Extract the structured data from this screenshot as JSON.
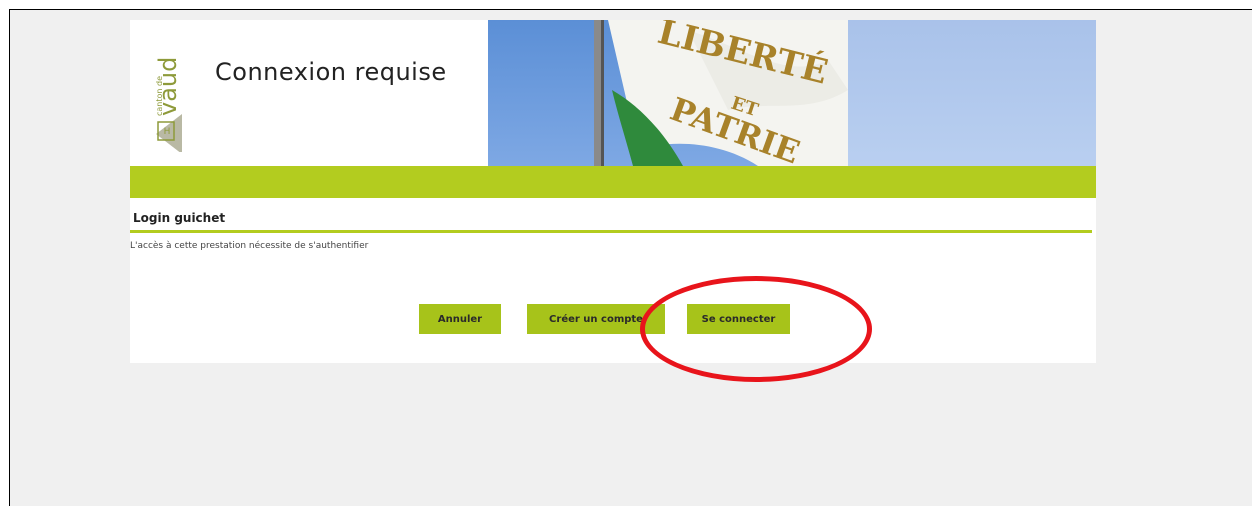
{
  "header": {
    "logo_text": "canton de vaud",
    "page_title": "Connexion requise",
    "banner_words": [
      "LIBERTÉ",
      "ET",
      "PATRIE"
    ]
  },
  "section": {
    "title": "Login guichet",
    "info": "L'accès à cette prestation nécessite de s'authentifier"
  },
  "buttons": {
    "cancel": "Annuler",
    "create_account": "Créer un compte",
    "connect": "Se connecter"
  },
  "colors": {
    "accent_green": "#b3cc1f",
    "button_green": "#a7c31a",
    "annotation_red": "#e8141b",
    "page_background": "#f0f0f0"
  },
  "annotation": {
    "shape": "ellipse",
    "highlights": "connect-button"
  }
}
